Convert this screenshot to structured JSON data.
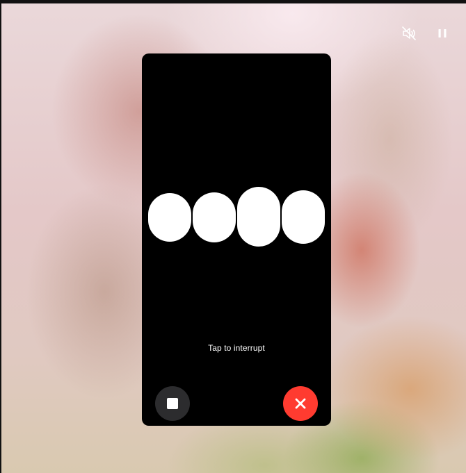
{
  "voice_mode": {
    "status_text": "Tap to interrupt"
  },
  "controls": {
    "mute_icon": "speaker-muted-icon",
    "pause_icon": "pause-icon",
    "stop_icon": "stop-icon",
    "close_icon": "close-x-icon"
  },
  "colors": {
    "panel_background": "#000000",
    "stop_button": "#2c2c2e",
    "close_button": "#ff3b30",
    "foreground": "#ffffff"
  }
}
